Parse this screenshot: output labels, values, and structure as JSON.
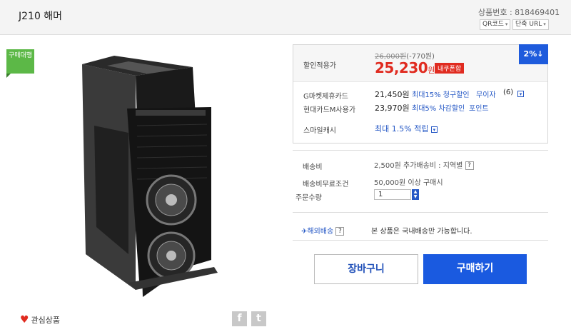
{
  "header": {
    "title": "J210 해머",
    "product_code": "상품번호 : 818469401",
    "qr_label": "QR코드",
    "short_url_label": "단축 URL"
  },
  "badge": {
    "label": "구매대행"
  },
  "price": {
    "discount_label": "할인적용가",
    "original": "26,000원",
    "discount_amount": "(-770원)",
    "sale_price": "25,230",
    "sale_unit": "원",
    "coupon_label": "내쿠폰함",
    "percent_badge": "2%↓"
  },
  "cards": [
    {
      "name": "G마켓제휴카드",
      "price": "21,450원",
      "benefit": "최대15% 청구할인",
      "extra": "무이자",
      "extra2": "(6)"
    },
    {
      "name": "현대카드M사용가",
      "price": "23,970원",
      "benefit": "최대5% 차감할인",
      "extra": "포인트",
      "extra2": ""
    }
  ],
  "smile_cash": {
    "label": "스마일캐시",
    "value": "최대 1.5% 적립"
  },
  "shipping": {
    "fee_label": "배송비",
    "fee_value": "2,500원 추가배송비 : 지역별",
    "free_label": "배송비무료조건",
    "free_value": "50,000원 이상 구매시",
    "qty_label": "주문수량",
    "qty_value": "1"
  },
  "overseas": {
    "label": "해외배송",
    "text": "본 상품은 국내배송만 가능합니다."
  },
  "buttons": {
    "cart": "장바구니",
    "buy": "구매하기"
  },
  "wishlist": {
    "label": "관심상품"
  },
  "share": {
    "facebook": "f",
    "twitter": "t"
  },
  "colors": {
    "accent_blue": "#1a5ae0",
    "sale_red": "#e02b20",
    "badge_green": "#5cb847"
  }
}
